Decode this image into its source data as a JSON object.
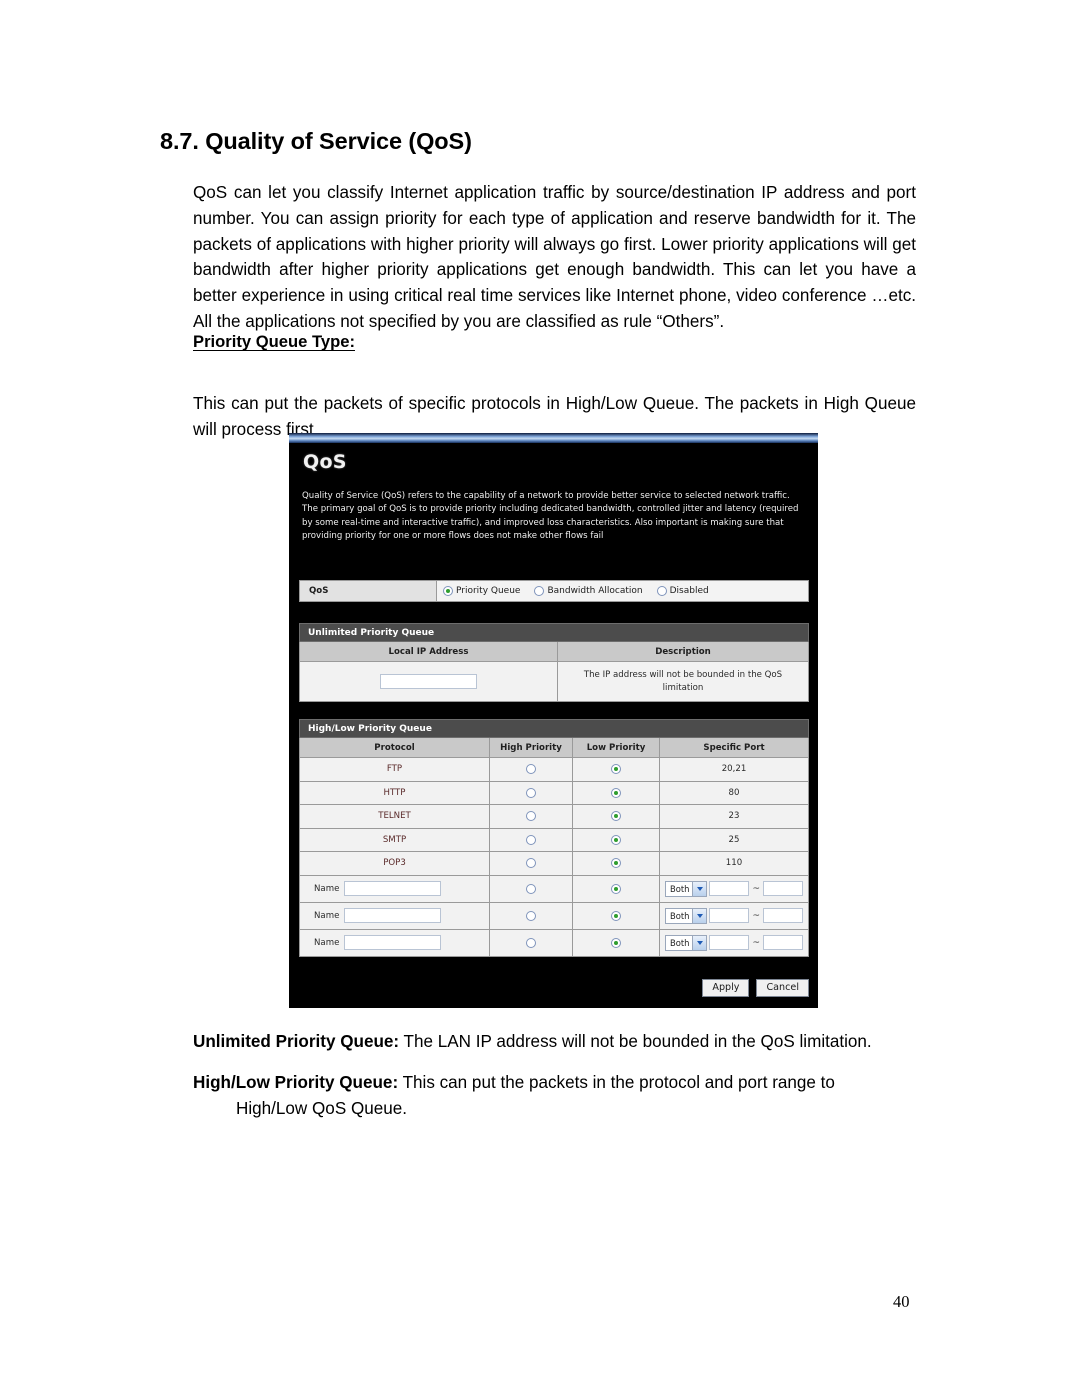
{
  "document": {
    "heading": "8.7. Quality of Service (QoS)",
    "intro_paragraph": "QoS can let you classify Internet application traffic by source/destination IP address and port number. You can assign priority for each type of application and reserve bandwidth for it. The packets of applications with higher priority will always go first. Lower priority applications will get bandwidth after higher priority applications get enough bandwidth. This can let you have a better experience in using critical real time services like Internet phone, video conference …etc. All the applications not specified by you are classified as rule “Others”.",
    "sub_heading": "Priority Queue Type: ",
    "priority_queue_paragraph": "This can put the packets of specific protocols in High/Low Queue. The packets in High Queue will process first.",
    "notes": [
      {
        "lead": "Unlimited Priority Queue:",
        "text": " The LAN IP address will not be bounded in the QoS limitation."
      },
      {
        "lead": "High/Low Priority Queue:",
        "text": " This can put the packets in the protocol and port range to",
        "indent": "High/Low QoS Queue."
      }
    ],
    "page_number": "40"
  },
  "ui": {
    "title": "QoS",
    "description": "Quality of Service (QoS) refers to the capability of a network to provide better service to selected network traffic. The primary goal of QoS is to provide priority including dedicated bandwidth, controlled jitter and latency (required by some real-time and interactive traffic), and improved loss characteristics. Also important is making sure that providing priority for one or more flows does not make other flows fail",
    "mode_row": {
      "label": "QoS",
      "options": [
        {
          "label": "Priority Queue",
          "selected": true
        },
        {
          "label": "Bandwidth Allocation",
          "selected": false
        },
        {
          "label": "Disabled",
          "selected": false
        }
      ]
    },
    "unlimited_priority_queue": {
      "section_title": "Unlimited Priority Queue",
      "headers": [
        "Local IP Address",
        "Description"
      ],
      "row": {
        "local_ip_value": "",
        "description": "The IP address will not be bounded in the QoS limitation"
      }
    },
    "high_low_priority_queue": {
      "section_title": "High/Low Priority Queue",
      "headers": [
        "Protocol",
        "High Priority",
        "Low Priority",
        "Specific Port"
      ],
      "protocol_rows": [
        {
          "protocol": "FTP",
          "high": false,
          "low": true,
          "port": "20,21"
        },
        {
          "protocol": "HTTP",
          "high": false,
          "low": true,
          "port": "80"
        },
        {
          "protocol": "TELNET",
          "high": false,
          "low": true,
          "port": "23"
        },
        {
          "protocol": "SMTP",
          "high": false,
          "low": true,
          "port": "25"
        },
        {
          "protocol": "POP3",
          "high": false,
          "low": true,
          "port": "110"
        }
      ],
      "custom_rows": [
        {
          "name_label": "Name",
          "name_value": "",
          "high": false,
          "low": true,
          "protocol_select": "Both",
          "port_start": "",
          "port_sep": "~",
          "port_end": ""
        },
        {
          "name_label": "Name",
          "name_value": "",
          "high": false,
          "low": true,
          "protocol_select": "Both",
          "port_start": "",
          "port_sep": "~",
          "port_end": ""
        },
        {
          "name_label": "Name",
          "name_value": "",
          "high": false,
          "low": true,
          "protocol_select": "Both",
          "port_start": "",
          "port_sep": "~",
          "port_end": ""
        }
      ]
    },
    "buttons": {
      "apply": "Apply",
      "cancel": "Cancel"
    }
  },
  "colors": {
    "panel_background": "#000000",
    "section_header": "#4c4c4c",
    "table_header": "#c9c9c9",
    "table_cell": "#f2f2f2",
    "radio_selected_dot": "#2f9e2f",
    "title_bar_accent": "#7da3d8"
  }
}
